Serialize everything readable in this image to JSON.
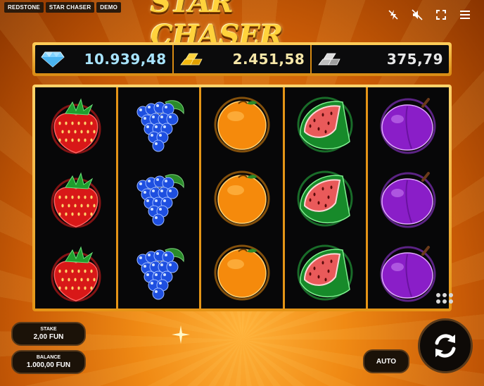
{
  "tags": [
    "REDSTONE",
    "STAR CHASER",
    "DEMO"
  ],
  "logo": "STAR CHASER",
  "top_icons": [
    "flash-off-icon",
    "sound-off-icon",
    "fullscreen-icon",
    "menu-icon"
  ],
  "jackpots": {
    "diamond": "10.939,48",
    "gold": "2.451,58",
    "silver": "375,79"
  },
  "reels": [
    [
      "strawberry",
      "strawberry",
      "strawberry"
    ],
    [
      "grapes",
      "grapes",
      "grapes"
    ],
    [
      "orange",
      "orange",
      "orange"
    ],
    [
      "watermelon",
      "watermelon",
      "watermelon"
    ],
    [
      "plum",
      "plum",
      "plum"
    ]
  ],
  "stake": {
    "label": "STAKE",
    "value": "2,00 FUN"
  },
  "balance": {
    "label": "BALANCE",
    "value": "1.000,00 FUN"
  },
  "auto_label": "AUTO",
  "colors": {
    "background": "#f08a14",
    "frame_gold": "#e49416",
    "reel_bg": "#070708",
    "diamond_text": "#a8e4ff"
  }
}
